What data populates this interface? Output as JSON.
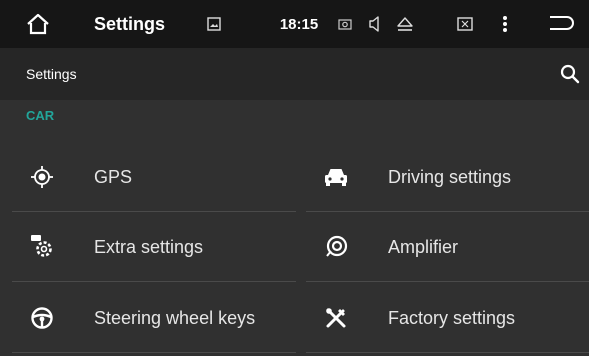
{
  "status_bar": {
    "title": "Settings",
    "time": "18:15",
    "icons": [
      "home-icon",
      "picture-icon",
      "camera-icon",
      "volume-icon",
      "eject-icon",
      "screenshot-icon",
      "more-icon",
      "back-icon"
    ]
  },
  "action_bar": {
    "title": "Settings",
    "search_icon": "search-icon"
  },
  "section": {
    "header": "CAR"
  },
  "items": [
    {
      "label": "GPS",
      "icon": "gps-icon"
    },
    {
      "label": "Driving settings",
      "icon": "car-icon"
    },
    {
      "label": "Extra settings",
      "icon": "settings-gear-icon"
    },
    {
      "label": "Amplifier",
      "icon": "speaker-icon"
    },
    {
      "label": "Steering wheel keys",
      "icon": "steering-wheel-icon"
    },
    {
      "label": "Factory settings",
      "icon": "tools-icon"
    }
  ],
  "colors": {
    "accent": "#22a59a",
    "status_bar": "#161616",
    "action_bar": "#262626",
    "background": "#303030",
    "text": "#e6e6e6",
    "divider": "#4a4a4a"
  }
}
